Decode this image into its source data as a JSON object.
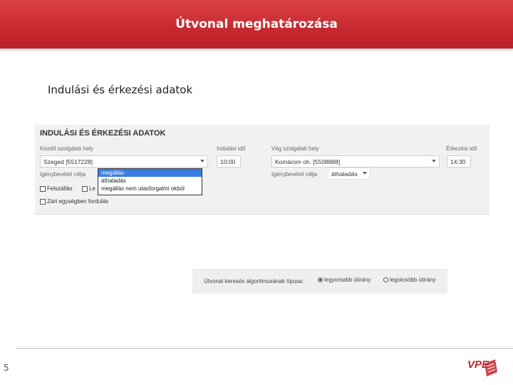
{
  "header": {
    "title": "Útvonal meghatározása"
  },
  "subtitle": "Indulási és érkezési adatok",
  "panel": {
    "title": "INDULÁSI ÉS ÉRKEZÉSI ADATOK",
    "start_location_label": "Kezdő szolgálati hely",
    "start_location_value": "Szeged [5517228]",
    "departure_time_label": "Indulási idő",
    "departure_time_value": "10:00",
    "end_location_label": "Vég szolgálati hely",
    "end_location_value": "Komárom oh. [5508888]",
    "arrival_time_label": "Érkezési idő",
    "arrival_time_value": "14:30",
    "purpose_label_left": "Igénybevétel célja",
    "purpose_label_right": "Igénybevétel célja",
    "purpose_right_value": "áthaladás",
    "purpose_dropdown_options": [
      "megállás",
      "áthaladás",
      "megállás nem utasforgalmi okból"
    ],
    "checkbox_felszallas": "Felszállás",
    "checkbox_le": "Le",
    "checkbox_closed_unit": "Zárt egységben fordulás"
  },
  "algorithm": {
    "label": "Útvonal keresés algoritmusának típusa:",
    "option_fastest": "legyorsabb útirány",
    "option_cheapest": "legolcsóbb útirány"
  },
  "footer": {
    "page_number": "5",
    "logo_text": "VPE"
  }
}
